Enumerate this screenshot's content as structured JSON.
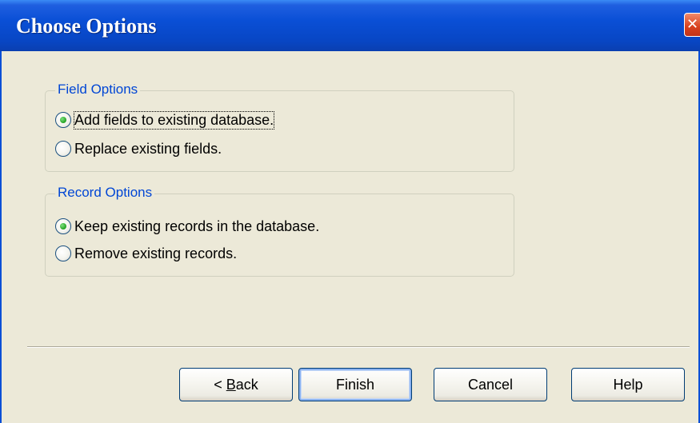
{
  "window": {
    "title": "Choose Options",
    "close_glyph": "✕"
  },
  "field_options": {
    "legend": "Field Options",
    "options": [
      {
        "label": "Add fields to existing database.",
        "selected": true
      },
      {
        "label": "Replace existing fields.",
        "selected": false
      }
    ]
  },
  "record_options": {
    "legend": "Record Options",
    "options": [
      {
        "label": "Keep existing records in the database.",
        "selected": true
      },
      {
        "label": "Remove existing records.",
        "selected": false
      }
    ]
  },
  "buttons": {
    "back_prefix": "< ",
    "back_mnemonic": "B",
    "back_rest": "ack",
    "finish": "Finish",
    "cancel": "Cancel",
    "help": "Help"
  },
  "colors": {
    "titlebar": "#0A4FD6",
    "dialog_bg": "#ECE9D8",
    "legend_text": "#0046D5",
    "radio_selected": "#21A121"
  }
}
